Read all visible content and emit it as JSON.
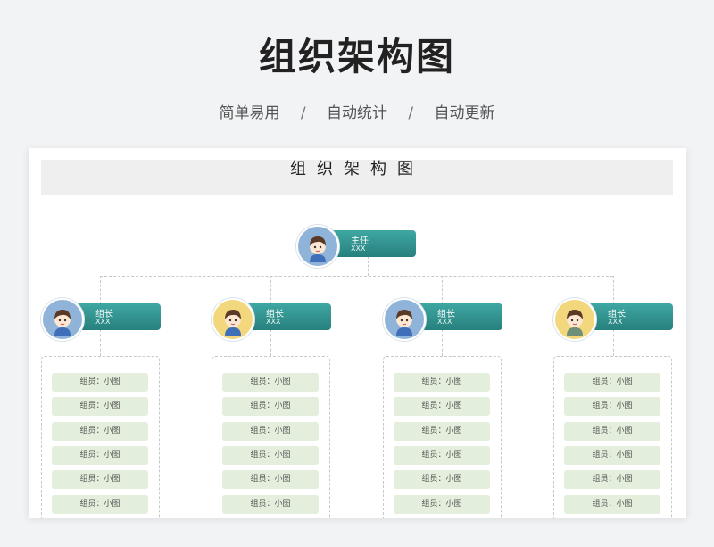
{
  "hero": {
    "title": "组织架构图",
    "features": [
      "简单易用",
      "自动统计",
      "自动更新"
    ],
    "separator": "/"
  },
  "sheet": {
    "title": "组织架构图"
  },
  "colors": {
    "accent": "#2f8f8b",
    "member_bg": "#e3efdc",
    "avatar_blue": "#8fb3d9",
    "avatar_yellow": "#f2d77c"
  },
  "director": {
    "role": "主任",
    "name": "XXX",
    "avatar": "girl-avatar-blue"
  },
  "leaders": [
    {
      "role": "组长",
      "name": "XXX",
      "avatar": "girl-avatar-blue",
      "members": [
        "组员：小图",
        "组员：小图",
        "组员：小图",
        "组员：小图",
        "组员：小图",
        "组员：小图"
      ]
    },
    {
      "role": "组长",
      "name": "XXX",
      "avatar": "girl-avatar-yellow",
      "members": [
        "组员：小图",
        "组员：小图",
        "组员：小图",
        "组员：小图",
        "组员：小图",
        "组员：小图"
      ]
    },
    {
      "role": "组长",
      "name": "XXX",
      "avatar": "girl-avatar-blue",
      "members": [
        "组员：小图",
        "组员：小图",
        "组员：小图",
        "组员：小图",
        "组员：小图",
        "组员：小图"
      ]
    },
    {
      "role": "组长",
      "name": "XXX",
      "avatar": "girl-avatar-yellow",
      "members": [
        "组员：小图",
        "组员：小图",
        "组员：小图",
        "组员：小图",
        "组员：小图",
        "组员：小图"
      ]
    }
  ]
}
